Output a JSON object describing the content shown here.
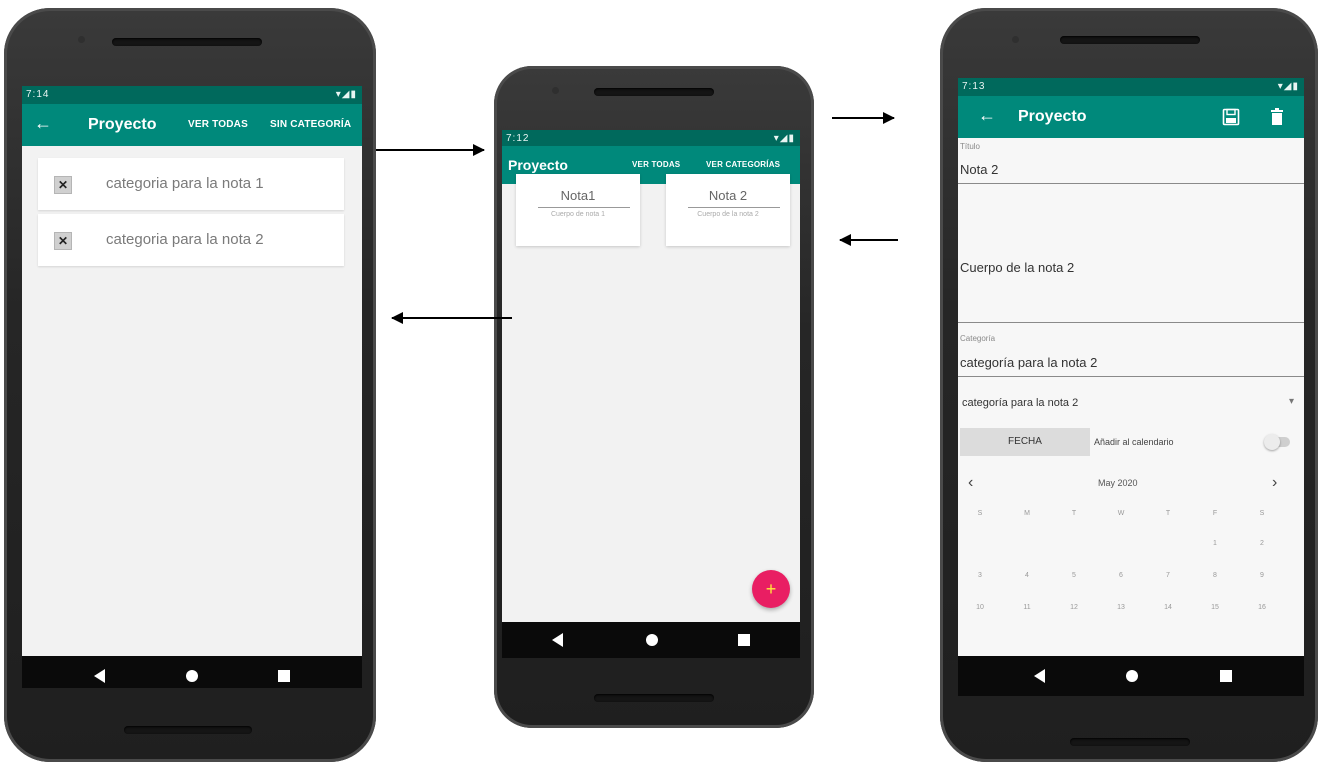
{
  "phone_left": {
    "status": {
      "time": "7:14",
      "icons": "▾◢▮"
    },
    "appbar": {
      "back": "←",
      "title": "Proyecto",
      "action1": "VER TODAS",
      "action2": "SIN CATEGORÍA"
    },
    "categories": [
      {
        "delete_icon": "✕",
        "label": "categoria para la nota 1"
      },
      {
        "delete_icon": "✕",
        "label": "categoria para la nota 2"
      }
    ]
  },
  "phone_middle": {
    "status": {
      "time": "7:12",
      "icons": "▾◢▮"
    },
    "appbar": {
      "title": "Proyecto",
      "action1": "VER TODAS",
      "action2": "VER CATEGORÍAS"
    },
    "notes": [
      {
        "title": "Nota1",
        "body": "Cuerpo de nota 1"
      },
      {
        "title": "Nota 2",
        "body": "Cuerpo de la nota 2"
      }
    ],
    "fab": "+"
  },
  "phone_right": {
    "status": {
      "time": "7:13",
      "icons": "▾◢▮"
    },
    "appbar": {
      "back": "←",
      "title": "Proyecto"
    },
    "form": {
      "title_label": "Título",
      "title_value": "Nota 2",
      "body_value": "Cuerpo de la nota 2",
      "category_label": "Categoría",
      "category_value": "categoría para la nota 2",
      "spinner_value": "categoría para la nota 2",
      "spinner_arrow": "▾",
      "date_button": "FECHA",
      "calendar_toggle_label": "Añadir al calendario"
    },
    "calendar": {
      "prev": "‹",
      "next": "›",
      "month": "May 2020",
      "weekdays": [
        "S",
        "M",
        "T",
        "W",
        "T",
        "F",
        "S"
      ],
      "week1": [
        "",
        "",
        "",
        "",
        "",
        "1",
        "2"
      ],
      "week2": [
        "3",
        "4",
        "5",
        "6",
        "7",
        "8",
        "9"
      ],
      "week3": [
        "10",
        "11",
        "12",
        "13",
        "14",
        "15",
        "16"
      ]
    }
  },
  "colors": {
    "appbar": "#00897b",
    "statusbar": "#00695c",
    "fab": "#e91e63",
    "navbar": "#0a0a0a",
    "screen_bg": "#f2f2f2"
  },
  "icons": {
    "save": "save-icon",
    "delete": "trash-icon",
    "back": "arrow-back-icon",
    "nav_back": "nav-back-icon",
    "nav_home": "nav-home-icon",
    "nav_recent": "nav-recents-icon"
  }
}
